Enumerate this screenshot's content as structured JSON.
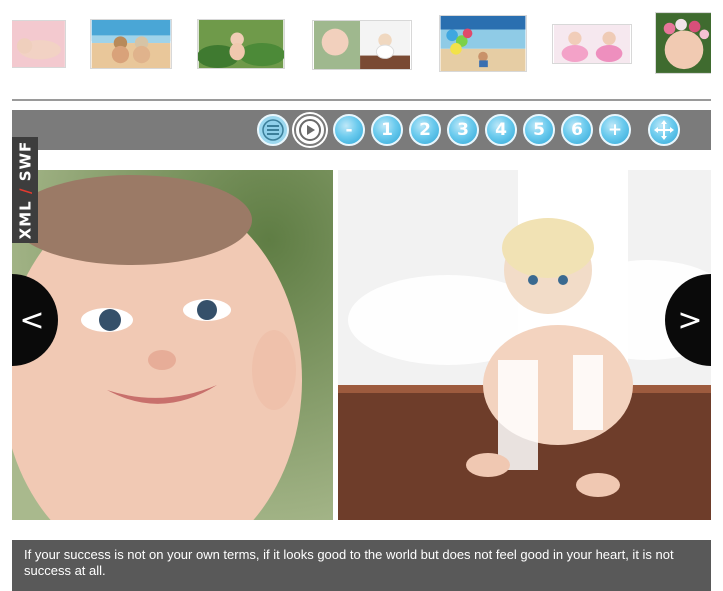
{
  "side_tab": {
    "left": "XML",
    "sep": "/",
    "right": "SWF"
  },
  "thumbnails": [
    {
      "name": "thumb-sleeping-baby",
      "scene": "pink"
    },
    {
      "name": "thumb-beach-kids",
      "scene": "beach"
    },
    {
      "name": "thumb-baby-on-leaves",
      "scene": "green"
    },
    {
      "name": "thumb-baby-duo",
      "scene": "duo"
    },
    {
      "name": "thumb-balloons-beach",
      "scene": "balloons"
    },
    {
      "name": "thumb-baby-pink-dress",
      "scene": "pinkduo"
    },
    {
      "name": "thumb-flower-crown",
      "scene": "flower"
    }
  ],
  "controls": {
    "menu_icon": "menu-icon",
    "play_icon": "play-icon",
    "prev_label": "-",
    "pages": [
      "1",
      "2",
      "3",
      "4",
      "5",
      "6"
    ],
    "next_label": "+",
    "fullscreen_icon": "fullscreen-icon"
  },
  "nav": {
    "prev": "<",
    "next": ">"
  },
  "caption": "If your success is not on your own terms, if it looks good to the world but does not feel good in your heart, it is not success at all.",
  "colors": {
    "accent": "#2fa6d6",
    "bar": "#7b7b7b",
    "caption_bg": "#595959",
    "tab_sep": "#e33a2f"
  }
}
